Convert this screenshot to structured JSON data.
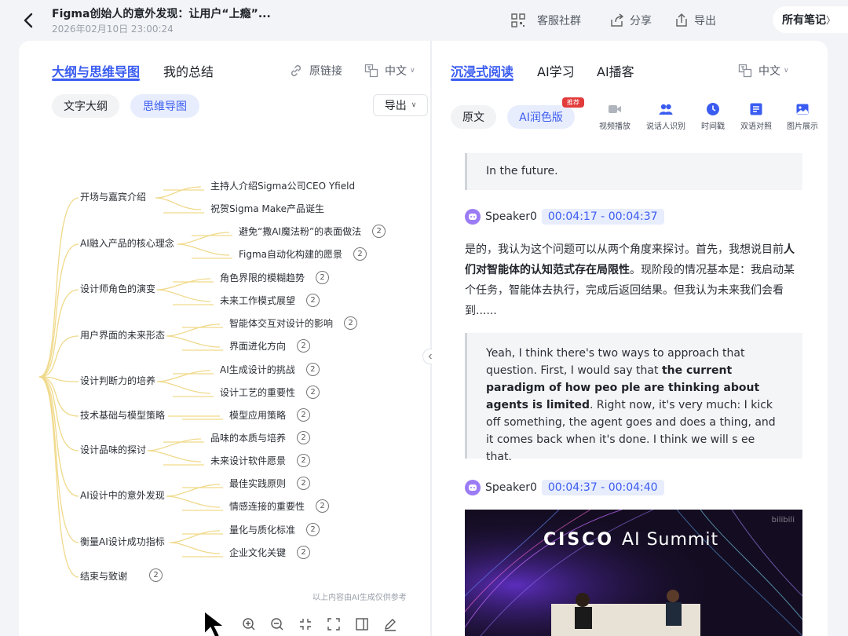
{
  "header": {
    "title": "Figma创始人的意外发现：让用户“上瘾”...",
    "datetime": "2026年02月10日 23:00:24",
    "actions": [
      {
        "icon": "group-qr-icon",
        "label": "客服社群"
      },
      {
        "icon": "share-icon",
        "label": "分享"
      },
      {
        "icon": "export-icon",
        "label": "导出"
      }
    ],
    "all_notes": "所有笔记",
    "all_notes_arrow": "〉"
  },
  "left": {
    "tabs": [
      "大纲与思维导图",
      "我的总结"
    ],
    "original_link": "原链接",
    "language": "中文",
    "view_pills": [
      "文字大纲",
      "思维导图"
    ],
    "export_label": "导出",
    "mindmap": {
      "categories": [
        "开场与嘉宾介绍",
        "AI融入产品的核心理念",
        "设计师角色的演变",
        "用户界面的未来形态",
        "设计判断力的培养",
        "技术基础与模型策略",
        "设计品味的探讨",
        "AI设计中的意外发现",
        "衡量AI设计成功指标",
        "结束与致谢"
      ],
      "leaves": [
        {
          "text": "主持人介绍Sigma公司CEO Yfield",
          "badge": ""
        },
        {
          "text": "祝贺Sigma Make产品诞生",
          "badge": ""
        },
        {
          "text": "避免“撒AI魔法粉”的表面做法",
          "badge": "2"
        },
        {
          "text": "Figma自动化构建的愿景",
          "badge": "2"
        },
        {
          "text": "角色界限的模糊趋势",
          "badge": "2"
        },
        {
          "text": "未来工作模式展望",
          "badge": "2"
        },
        {
          "text": "智能体交互对设计的影响",
          "badge": "2"
        },
        {
          "text": "界面进化方向",
          "badge": "2"
        },
        {
          "text": "AI生成设计的挑战",
          "badge": "2"
        },
        {
          "text": "设计工艺的重要性",
          "badge": "2"
        },
        {
          "text": "模型应用策略",
          "badge": "2"
        },
        {
          "text": "品味的本质与培养",
          "badge": "2"
        },
        {
          "text": "未来设计软件愿景",
          "badge": "2"
        },
        {
          "text": "最佳实践原则",
          "badge": "2"
        },
        {
          "text": "情感连接的重要性",
          "badge": "2"
        },
        {
          "text": "量化与质化标准",
          "badge": "2"
        },
        {
          "text": "企业文化关键",
          "badge": "2"
        }
      ],
      "end_badge": "2",
      "note": "以上内容由AI生成仅供参考"
    }
  },
  "right": {
    "tabs": [
      "沉浸式阅读",
      "AI学习",
      "AI播客"
    ],
    "language": "中文",
    "view_pills": [
      "原文",
      "AI润色版"
    ],
    "recommend_badge": "推荐",
    "features": [
      {
        "icon": "video-camera-icon",
        "label": "视频播放"
      },
      {
        "icon": "speaker-id-icon",
        "label": "说话人识别"
      },
      {
        "icon": "clock-icon",
        "label": "时间戳"
      },
      {
        "icon": "bilingual-icon",
        "label": "双语对照"
      },
      {
        "icon": "image-icon",
        "label": "图片展示"
      }
    ],
    "quote1": "In the future.",
    "speaker1": {
      "name": "Speaker0",
      "time": "00:04:17 - 00:04:37"
    },
    "para1_a": "是的，我认为这个问题可以从两个角度来探讨。首先，我想说目前",
    "para1_b": "人们对智能体的认知范式存在局限性",
    "para1_c": "。现阶段的情况基本是：我启动某个任务，智能体去执行，完成后返回结果。但我认为未来我们会看到......",
    "quote2_a": "Yeah, I think there's two ways to approach that question. First, I would say that ",
    "quote2_b": "the current paradigm of how peo ple are thinking about agents is limited",
    "quote2_c": ". Right now, it's very much: I kick off something, the agent goes and does a thing, and it comes back when it's done. I think we will s ee that.",
    "speaker2": {
      "name": "Speaker0",
      "time": "00:04:37 - 00:04:40"
    },
    "video": {
      "brand": "CISCO",
      "title": "AI Summit",
      "watermark": "bilibili"
    }
  }
}
